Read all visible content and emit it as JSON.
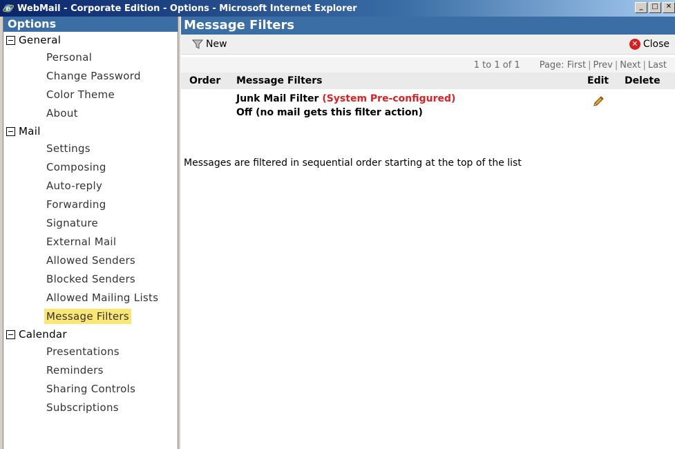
{
  "window": {
    "title": "WebMail - Corporate Edition - Options - Microsoft Internet Explorer",
    "minimize_label": "_",
    "maximize_label": "□",
    "close_label": "✕"
  },
  "sidebar": {
    "header": "Options",
    "groups": [
      {
        "label": "General",
        "items": [
          "Personal",
          "Change Password",
          "Color Theme",
          "About"
        ]
      },
      {
        "label": "Mail",
        "items": [
          "Settings",
          "Composing",
          "Auto-reply",
          "Forwarding",
          "Signature",
          "External Mail",
          "Allowed Senders",
          "Blocked Senders",
          "Allowed Mailing Lists",
          "Message Filters"
        ]
      },
      {
        "label": "Calendar",
        "items": [
          "Presentations",
          "Reminders",
          "Sharing Controls",
          "Subscriptions"
        ]
      }
    ],
    "selected": "Message Filters"
  },
  "main": {
    "title": "Message Filters",
    "toolbar": {
      "new_label": "New",
      "close_label": "Close"
    },
    "pager": {
      "range": "1 to 1 of 1",
      "page_label": "Page:",
      "first": "First",
      "prev": "Prev",
      "next": "Next",
      "last": "Last"
    },
    "columns": {
      "order": "Order",
      "filters": "Message Filters",
      "edit": "Edit",
      "delete": "Delete"
    },
    "filters": [
      {
        "name": "Junk Mail Filter",
        "tag": "(System Pre-configured)",
        "status": "Off (no mail gets this filter action)"
      }
    ],
    "note": "Messages are filtered in sequential order starting at the top of the list"
  },
  "colors": {
    "header_blue": "#3a6ea5",
    "selected_highlight": "#fce774",
    "tag_red": "#e02020",
    "close_red": "#d81e1e"
  },
  "icons": {
    "app": "ie-icon",
    "new": "funnel-icon",
    "close": "close-circle-icon",
    "edit": "pencil-icon"
  }
}
